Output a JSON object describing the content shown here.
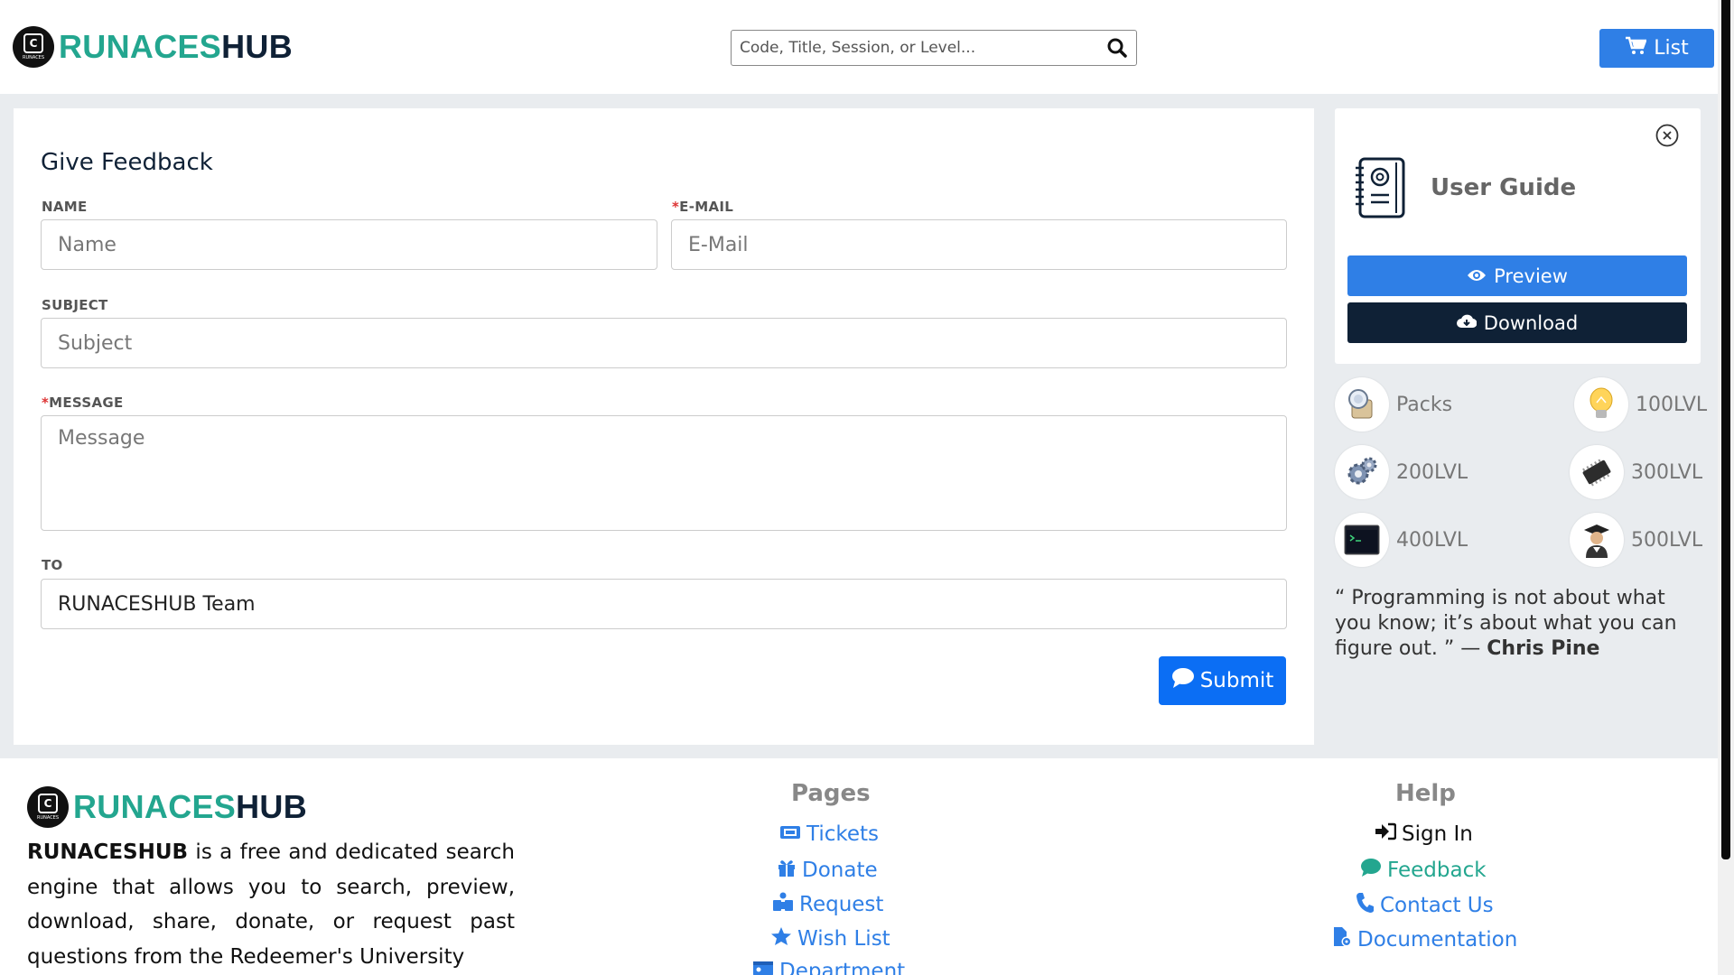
{
  "brand": {
    "part1": "RUNACES",
    "part2": "HUB",
    "badge_letter": "C",
    "badge_text": "RUNACES"
  },
  "search": {
    "placeholder": "Code, Title, Session, or Level...",
    "icon": "search-icon"
  },
  "header": {
    "list_label": "List",
    "list_icon": "cart-icon"
  },
  "form": {
    "title": "Give Feedback",
    "name": {
      "label": "NAME",
      "placeholder": "Name"
    },
    "email": {
      "label": "E-MAIL",
      "required_mark": "*",
      "placeholder": "E-Mail"
    },
    "subject": {
      "label": "SUBJECT",
      "placeholder": "Subject"
    },
    "message": {
      "label": "MESSAGE",
      "required_mark": "*",
      "placeholder": "Message"
    },
    "to": {
      "label": "TO",
      "value": "RUNACESHUB Team"
    },
    "submit_label": "Submit"
  },
  "guide": {
    "title": "User Guide",
    "preview_label": "Preview",
    "download_label": "Download"
  },
  "levels": [
    {
      "label": "Packs",
      "icon": "packs-icon"
    },
    {
      "label": "100LVL",
      "icon": "lightbulb-icon"
    },
    {
      "label": "200LVL",
      "icon": "gears-icon"
    },
    {
      "label": "300LVL",
      "icon": "chip-icon"
    },
    {
      "label": "400LVL",
      "icon": "terminal-icon"
    },
    {
      "label": "500LVL",
      "icon": "graduate-icon"
    }
  ],
  "quote": {
    "text": "“ Programming is not about what you know; it’s about what you can figure out. ” — ",
    "author": "Chris Pine"
  },
  "footer": {
    "brand_name": "RUNACESHUB",
    "description": " is a free and dedicated search engine that allows you to search, preview, download, share, donate, or request past questions from the Redeemer's University",
    "pages_title": "Pages",
    "pages": [
      "Tickets",
      "Donate",
      "Request",
      "Wish List",
      "Department"
    ],
    "help_title": "Help",
    "help": [
      "Sign In",
      "Feedback",
      "Contact Us",
      "Documentation"
    ]
  },
  "colors": {
    "primary": "#2f7fe6",
    "submit": "#0b6ef4",
    "navy": "#0f2136",
    "teal": "#23a68f"
  }
}
